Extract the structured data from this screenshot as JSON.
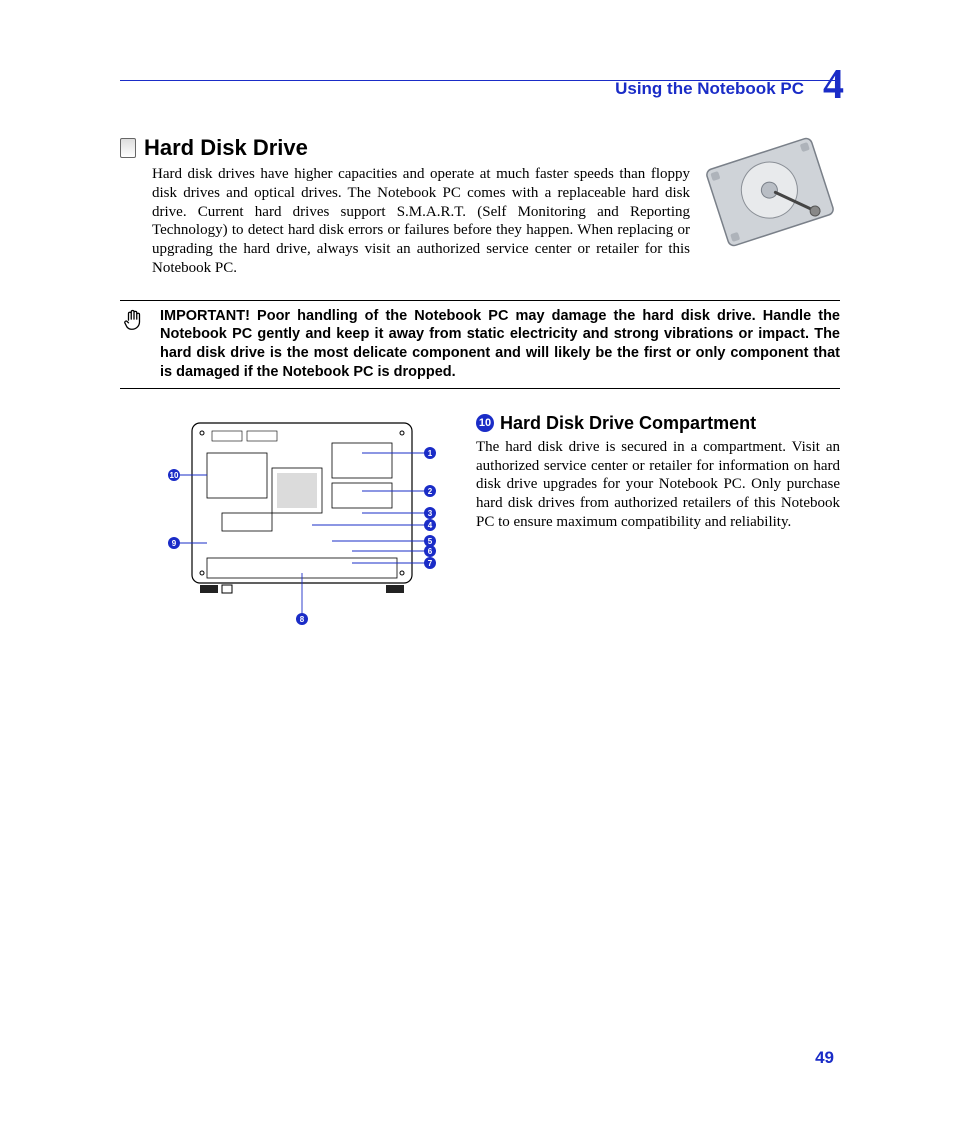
{
  "header": {
    "chapter_label": "Using the Notebook PC",
    "chapter_number": "4"
  },
  "section1": {
    "title": "Hard Disk Drive",
    "body": "Hard disk drives have higher capacities and operate at much faster speeds than floppy disk drives and optical drives. The Notebook PC comes with a replaceable hard disk drive. Current hard drives support S.M.A.R.T. (Self Monitoring and Reporting Technology) to detect hard disk errors or failures before they happen. When replacing or upgrading the hard drive, always visit an authorized service center or retailer for this Notebook PC."
  },
  "important": {
    "text": "IMPORTANT!  Poor handling of the Notebook PC may damage the hard disk drive. Handle the Notebook PC gently and keep it away from static electricity and strong vibrations or impact. The hard disk drive is the most delicate component and will likely be the first or only component that is damaged if the Notebook PC is dropped."
  },
  "section2": {
    "callout_number": "10",
    "title": "Hard Disk Drive Compartment",
    "body": "The hard disk drive is secured in a compartment. Visit an authorized service center or retailer for information on hard disk drive upgrades for your Notebook PC. Only purchase hard disk drives from authorized retailers of this Notebook PC to ensure maximum compatibility and reliability."
  },
  "diagram": {
    "callouts_right": [
      "1",
      "2",
      "3",
      "4",
      "5",
      "6",
      "7"
    ],
    "callout_bottom": "8",
    "callouts_left": [
      "9",
      "10"
    ]
  },
  "page_number": "49"
}
